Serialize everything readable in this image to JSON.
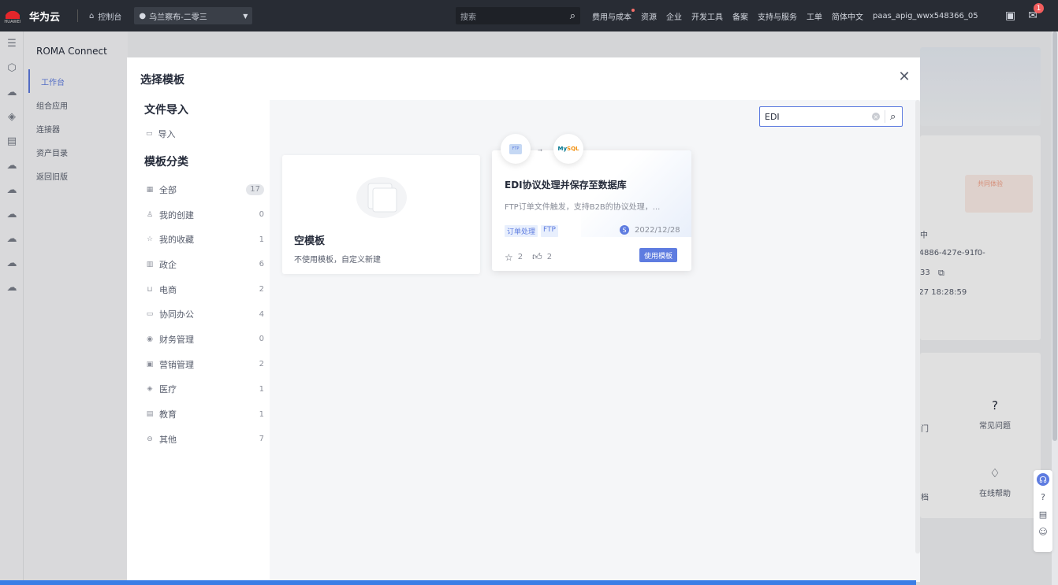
{
  "topbar": {
    "logo_text": "HUAWEI",
    "brand": "华为云",
    "console": "控制台",
    "region": "乌兰察布-二零三",
    "search_placeholder": "搜索",
    "nav": [
      "费用与成本",
      "资源",
      "企业",
      "开发工具",
      "备案",
      "支持与服务",
      "工单",
      "简体中文",
      "paas_apig_wwx548366_05"
    ],
    "badge": "1"
  },
  "subnav": {
    "title": "ROMA Connect",
    "items": [
      "工作台",
      "组合应用",
      "连接器",
      "资产目录",
      "返回旧版"
    ]
  },
  "background": {
    "text1": "中",
    "text2": "-4886-427e-91f0-",
    "text3": "33",
    "text4": "/27 18:28:59",
    "tile1_label": "常见问题",
    "tile2_label": "在线帮助",
    "tile_cut1": "门",
    "tile_cut2": "档",
    "promo": "共同体验"
  },
  "modal": {
    "title": "选择模板",
    "file_import": {
      "heading": "文件导入",
      "import_label": "导入"
    },
    "categories": {
      "heading": "模板分类",
      "items": [
        {
          "icon": "grid-icon",
          "label": "全部",
          "count": "17"
        },
        {
          "icon": "user-icon",
          "label": "我的创建",
          "count": "0"
        },
        {
          "icon": "star-icon",
          "label": "我的收藏",
          "count": "1"
        },
        {
          "icon": "building-icon",
          "label": "政企",
          "count": "6"
        },
        {
          "icon": "cart-icon",
          "label": "电商",
          "count": "2"
        },
        {
          "icon": "briefcase-icon",
          "label": "协同办公",
          "count": "4"
        },
        {
          "icon": "coin-icon",
          "label": "财务管理",
          "count": "0"
        },
        {
          "icon": "chart-icon",
          "label": "营销管理",
          "count": "2"
        },
        {
          "icon": "medical-icon",
          "label": "医疗",
          "count": "1"
        },
        {
          "icon": "book-icon",
          "label": "教育",
          "count": "1"
        },
        {
          "icon": "minus-circle-icon",
          "label": "其他",
          "count": "7"
        }
      ]
    },
    "search": {
      "value": "EDI"
    },
    "blank_template": {
      "title": "空模板",
      "desc": "不使用模板，自定义新建"
    },
    "template_card": {
      "title": "EDI协议处理并保存至数据库",
      "desc": "FTP订单文件触发，支持B2B的协议处理，...",
      "tags": [
        "订单处理",
        "FTP"
      ],
      "author_initial": "S",
      "date": "2022/12/28",
      "favorites": "2",
      "likes": "2",
      "use_button": "使用模板",
      "connector_left": "FTP",
      "connector_right_a": "My",
      "connector_right_b": "SQL"
    }
  }
}
